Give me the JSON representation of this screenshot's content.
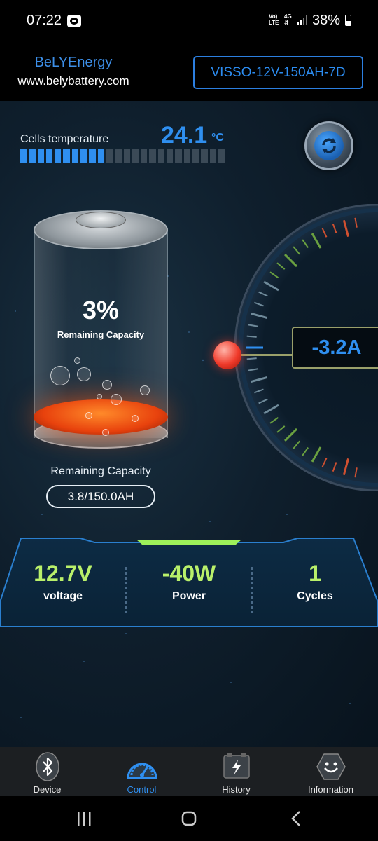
{
  "status_bar": {
    "time": "07:22",
    "network_top": "Vo)",
    "network_bottom": "LTE",
    "network_type": "4G",
    "battery_percent": "38%"
  },
  "header": {
    "brand": "BeLYEnergy",
    "website": "www.belybattery.com",
    "device_name": "VISSO-12V-150AH-7D"
  },
  "temperature": {
    "label": "Cells temperature",
    "value": "24.1",
    "unit": "°C",
    "bar_segments_total": 24,
    "bar_segments_on": 10
  },
  "battery": {
    "percent_text": "3%",
    "percent_label": "Remaining Capacity",
    "remaining_label": "Remaining Capacity",
    "remaining_value": "3.8/150.0AH",
    "level": 0.03
  },
  "current": {
    "value": "-3.2A"
  },
  "stats": [
    {
      "value": "12.7V",
      "label": "voltage"
    },
    {
      "value": "-40W",
      "label": "Power"
    },
    {
      "value": "1",
      "label": "Cycles"
    }
  ],
  "nav": [
    {
      "label": "Device",
      "icon": "bluetooth-icon",
      "active": false
    },
    {
      "label": "Control",
      "icon": "gauge-icon",
      "active": true
    },
    {
      "label": "History",
      "icon": "history-icon",
      "active": false
    },
    {
      "label": "Information",
      "icon": "smiley-icon",
      "active": false
    }
  ],
  "colors": {
    "accent_blue": "#2f8ff0",
    "stat_green": "#b9f06a",
    "liquid_orange": "#ff6a1a"
  }
}
